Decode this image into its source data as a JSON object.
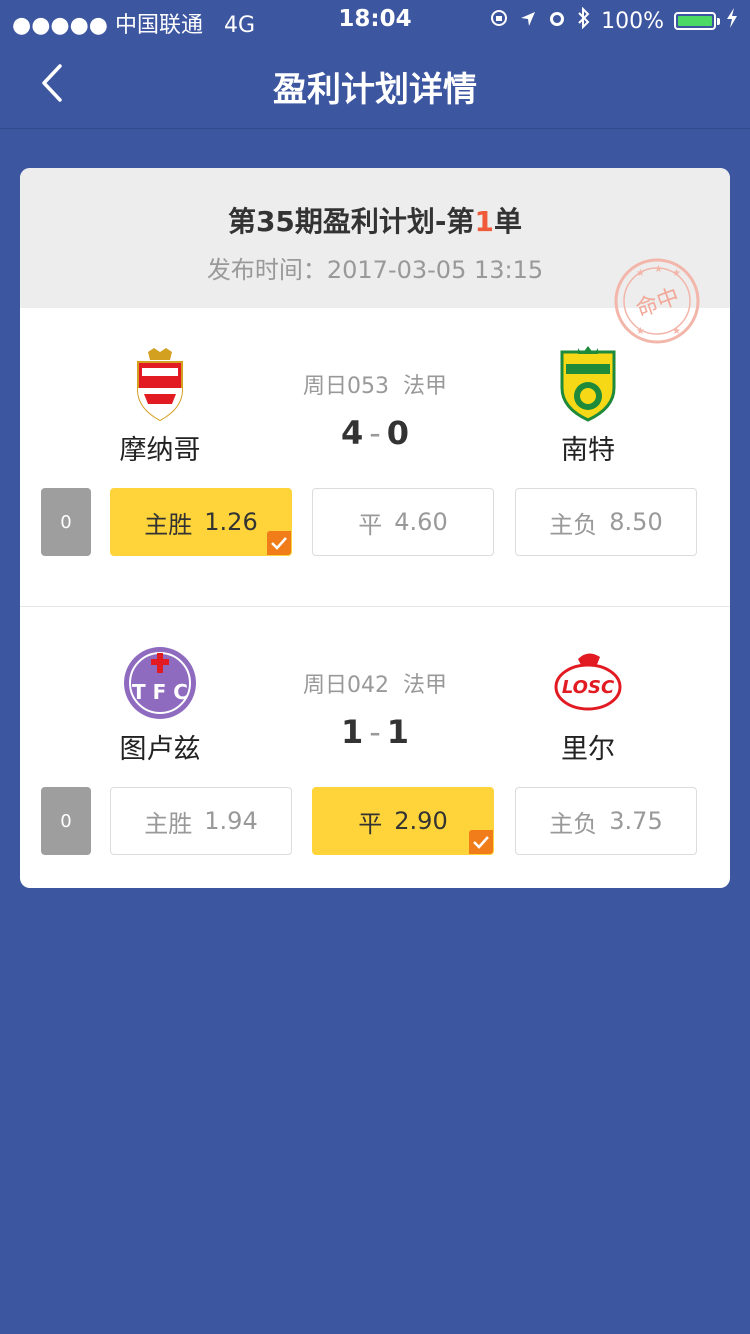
{
  "status": {
    "carrier": "●●●●● 中国联通",
    "network": "4G",
    "time": "18:04",
    "battery": "100%"
  },
  "nav": {
    "title": "盈利计划详情"
  },
  "plan": {
    "title_prefix": "第35期盈利计划-第",
    "title_number": "1",
    "title_suffix": "单",
    "publish_label": "发布时间：",
    "publish_time": "2017-03-05 13:15",
    "stamp_text": "命中",
    "accent": "#f05a3a"
  },
  "matches": [
    {
      "home": "摩纳哥",
      "away": "南特",
      "code": "周日053",
      "league": "法甲",
      "home_score": "4",
      "away_score": "0",
      "zero": "0",
      "odds": [
        {
          "label": "主胜",
          "value": "1.26",
          "selected": true
        },
        {
          "label": "平",
          "value": "4.60",
          "selected": false
        },
        {
          "label": "主负",
          "value": "8.50",
          "selected": false
        }
      ]
    },
    {
      "home": "图卢兹",
      "away": "里尔",
      "code": "周日042",
      "league": "法甲",
      "home_score": "1",
      "away_score": "1",
      "zero": "0",
      "odds": [
        {
          "label": "主胜",
          "value": "1.94",
          "selected": false
        },
        {
          "label": "平",
          "value": "2.90",
          "selected": true
        },
        {
          "label": "主负",
          "value": "3.75",
          "selected": false
        }
      ]
    }
  ],
  "colors": {
    "background": "#3d56a0",
    "selected": "#ffd43a",
    "check": "#f07d1a"
  }
}
